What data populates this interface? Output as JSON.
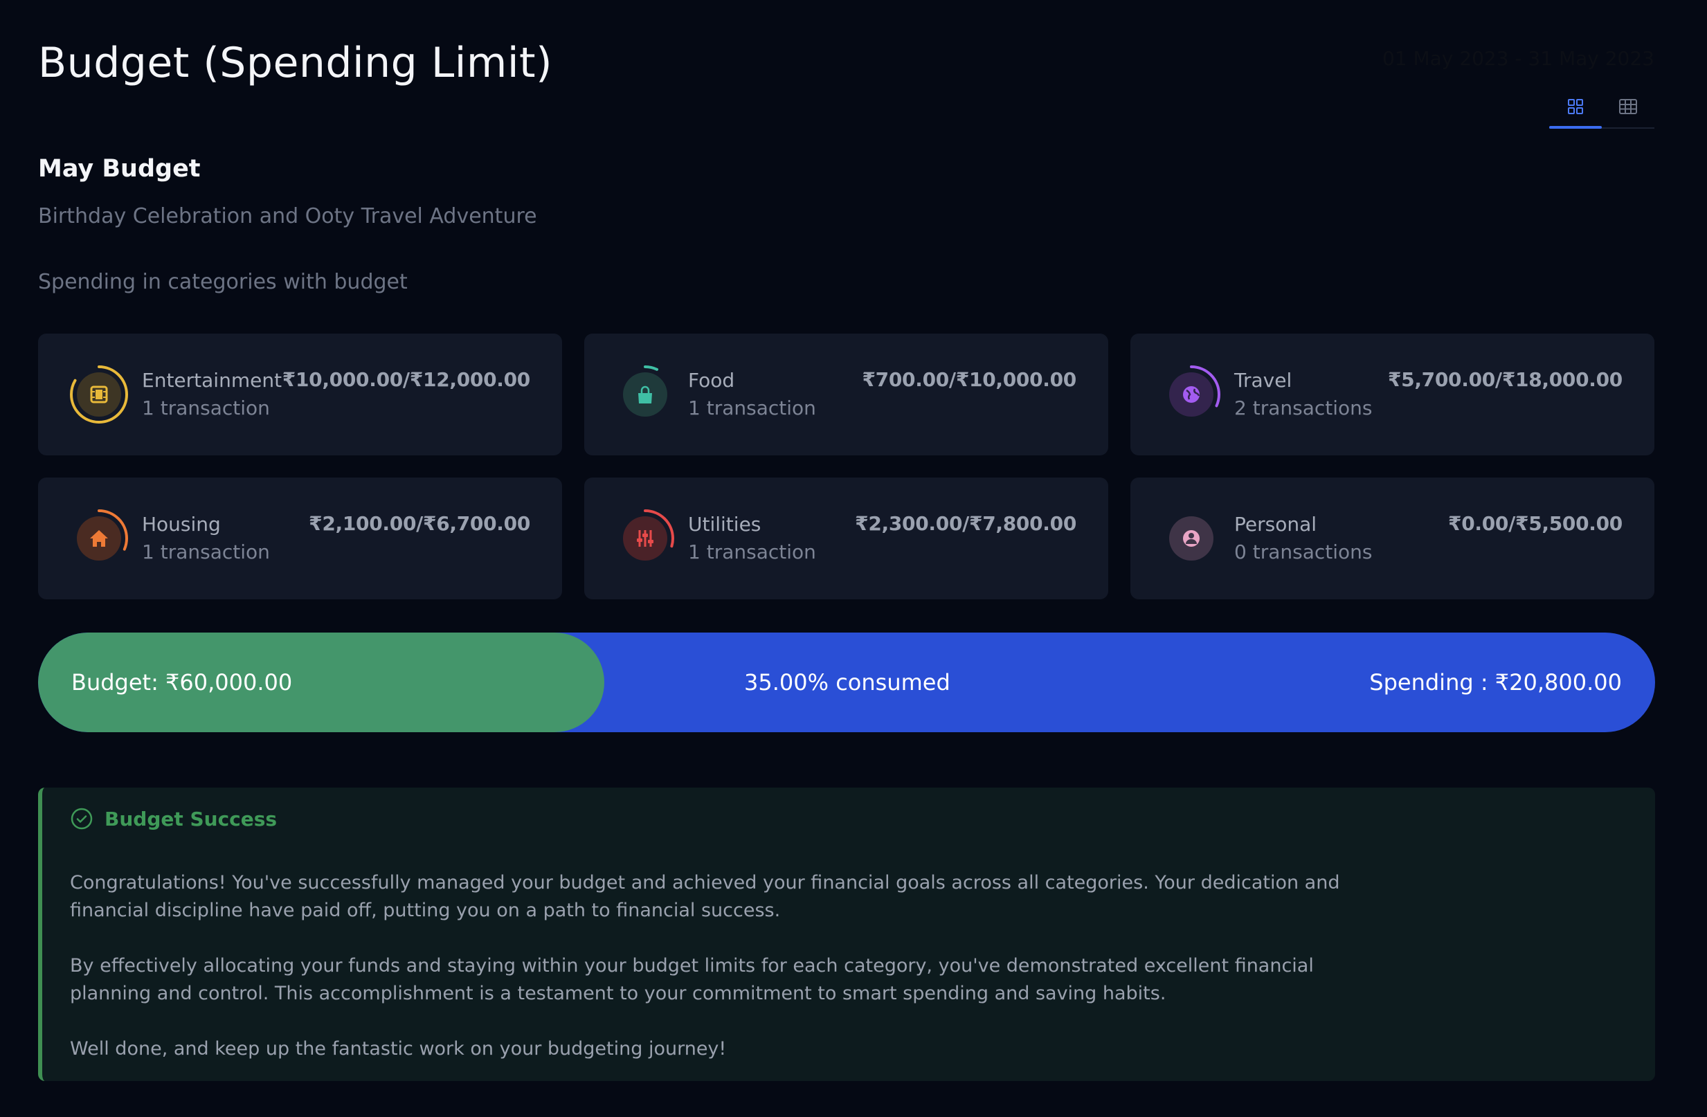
{
  "header": {
    "title": "Budget (Spending Limit)",
    "date_range": "01 May 2023 - 31 May 2023",
    "views": [
      {
        "name": "grid-view-icon",
        "active": true
      },
      {
        "name": "table-view-icon",
        "active": false
      }
    ]
  },
  "budget": {
    "name": "May Budget",
    "description": "Birthday Celebration and Ooty Travel Adventure",
    "section_label": "Spending in categories with budget"
  },
  "categories": [
    {
      "name": "Entertainment",
      "count": "1 transaction",
      "amount": "₹10,000.00/₹12,000.00",
      "spent": 10000,
      "limit": 12000,
      "color": "#e8b93a",
      "bg": "#3d3524",
      "icon": "film-icon"
    },
    {
      "name": "Food",
      "count": "1 transaction",
      "amount": "₹700.00/₹10,000.00",
      "spent": 700,
      "limit": 10000,
      "color": "#3fbfa5",
      "bg": "#1f3a3b",
      "icon": "shopping-bag-icon"
    },
    {
      "name": "Travel",
      "count": "2 transactions",
      "amount": "₹5,700.00/₹18,000.00",
      "spent": 5700,
      "limit": 18000,
      "color": "#a35cf0",
      "bg": "#33244d",
      "icon": "globe-icon"
    },
    {
      "name": "Housing",
      "count": "1 transaction",
      "amount": "₹2,100.00/₹6,700.00",
      "spent": 2100,
      "limit": 6700,
      "color": "#ee7a36",
      "bg": "#4a2b22",
      "icon": "home-icon"
    },
    {
      "name": "Utilities",
      "count": "1 transaction",
      "amount": "₹2,300.00/₹7,800.00",
      "spent": 2300,
      "limit": 7800,
      "color": "#e64a4a",
      "bg": "#4a2228",
      "icon": "sliders-icon"
    },
    {
      "name": "Personal",
      "count": "0 transactions",
      "amount": "₹0.00/₹5,500.00",
      "spent": 0,
      "limit": 5500,
      "color": "#e9a5c5",
      "bg": "#3f3447",
      "icon": "user-icon"
    }
  ],
  "progress": {
    "budget_label": "Budget: ₹60,000.00",
    "consumed_label": "35.00% consumed",
    "spending_label": "Spending : ₹20,800.00",
    "consumed_fraction": 0.35,
    "fill_color": "#44966b",
    "track_color": "#2a4fd6"
  },
  "alert": {
    "title": "Budget Success",
    "paragraphs": [
      "Congratulations! You've successfully managed your budget and achieved your financial goals across all categories. Your dedication and financial discipline have paid off, putting you on a path to financial success.",
      "By effectively allocating your funds and staying within your budget limits for each category, you've demonstrated excellent financial planning and control. This accomplishment is a testament to your commitment to smart spending and saving habits.",
      "Well done, and keep up the fantastic work on your budgeting journey!"
    ]
  }
}
